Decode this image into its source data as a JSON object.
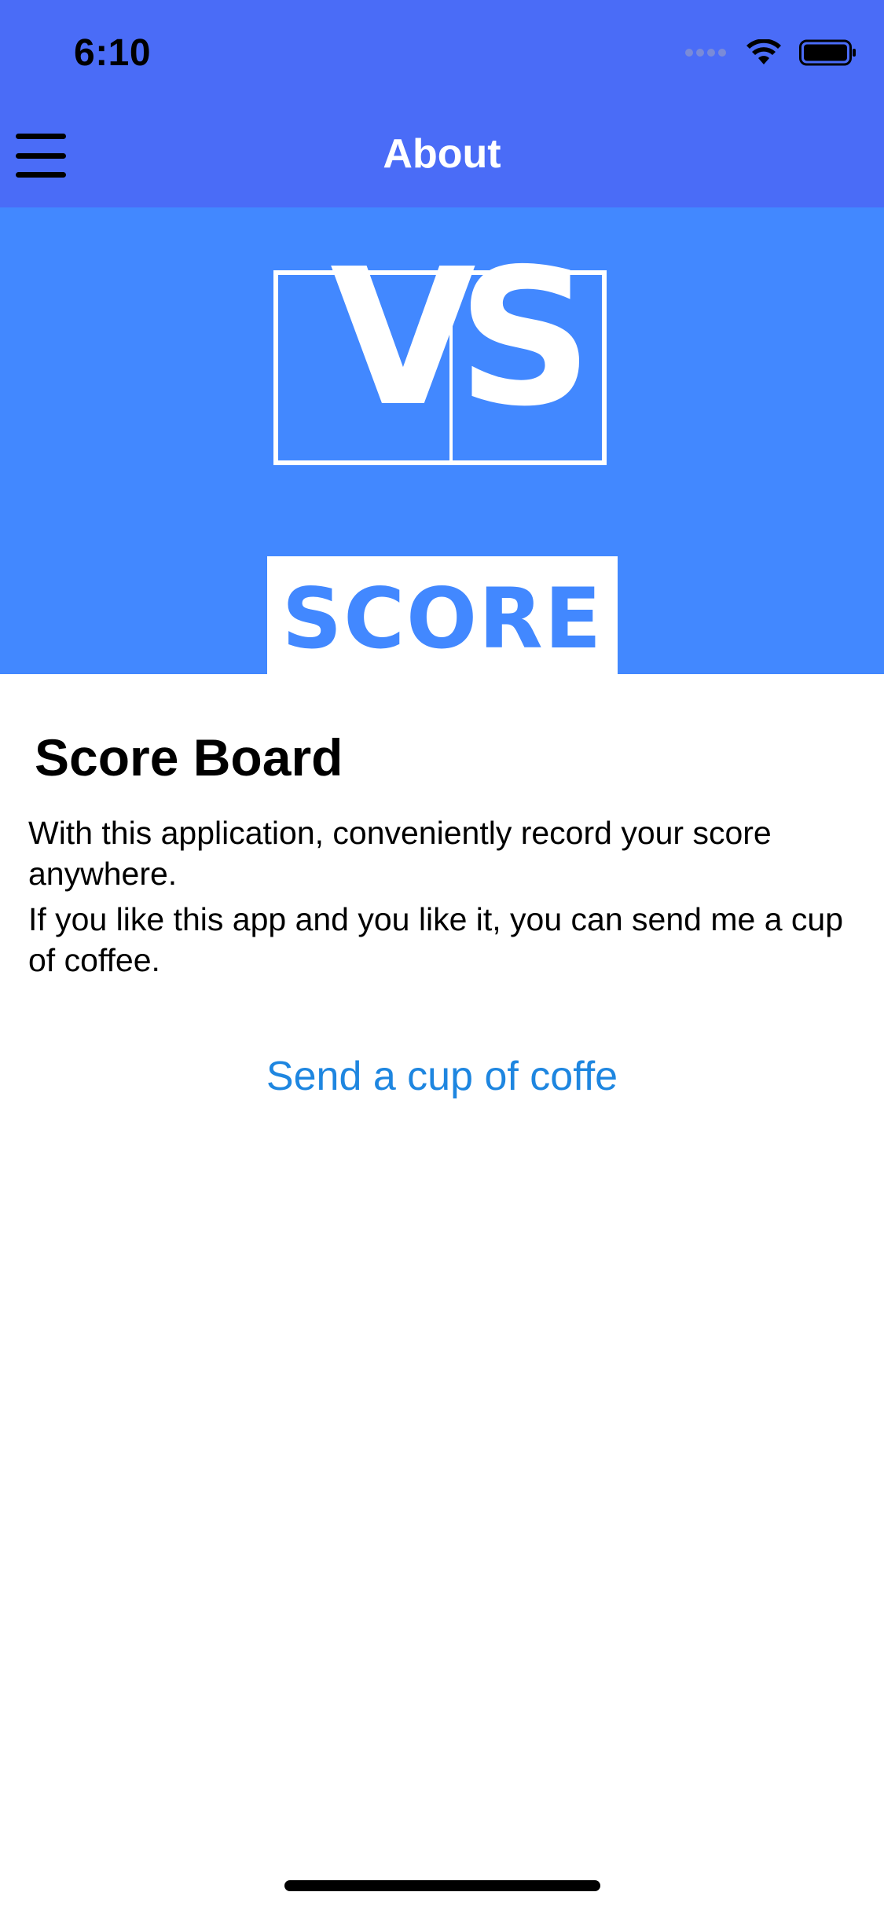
{
  "status_bar": {
    "time": "6:10"
  },
  "nav": {
    "title": "About",
    "menu_icon": "hamburger-menu-icon"
  },
  "hero": {
    "logo_vs": "VS",
    "logo_score": "SCORE",
    "background_color": "#4288FF"
  },
  "content": {
    "title": "Score Board",
    "paragraphs": [
      "With this application, conveniently record your score anywhere.",
      "If you like this app and you like it, you can send me a cup of coffee."
    ],
    "link_label": "Send a cup of coffe"
  },
  "colors": {
    "navbar": "#4A6CF7",
    "link": "#1E86E0"
  }
}
